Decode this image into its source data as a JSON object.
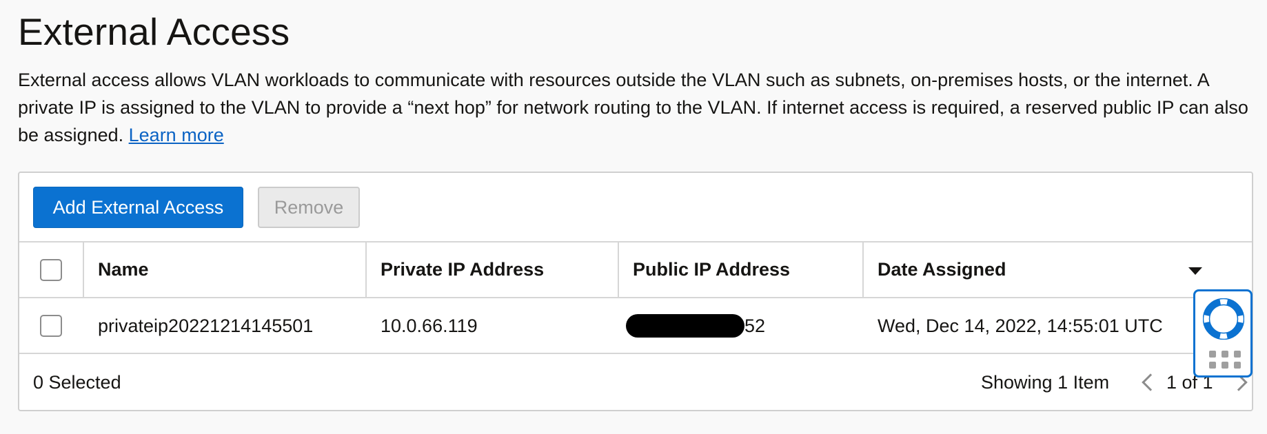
{
  "page": {
    "title": "External Access",
    "description": "External access allows VLAN workloads to communicate with resources outside the VLAN such as subnets, on-premises hosts, or the internet. A private IP is assigned to the VLAN to provide a “next hop” for network routing to the VLAN. If internet access is required, a reserved public IP can also be assigned.",
    "learn_more": "Learn more"
  },
  "toolbar": {
    "add_label": "Add External Access",
    "remove_label": "Remove"
  },
  "table": {
    "columns": [
      "Name",
      "Private IP Address",
      "Public IP Address",
      "Date Assigned"
    ],
    "rows": [
      {
        "name": "privateip20221214145501",
        "private_ip": "10.0.66.119",
        "public_ip_visible_suffix": "52",
        "date_assigned": "Wed, Dec 14, 2022, 14:55:01 UTC"
      }
    ]
  },
  "footer": {
    "selected": "0 Selected",
    "showing": "Showing 1 Item",
    "pagination": "1 of 1"
  },
  "icons": {
    "sort": "caret-down-icon",
    "help": "lifebuoy-icon",
    "grid": "grid-dots-icon",
    "prev": "chevron-left-icon",
    "next": "chevron-right-icon"
  },
  "colors": {
    "primary": "#0b72d1",
    "link": "#0b63c4"
  }
}
